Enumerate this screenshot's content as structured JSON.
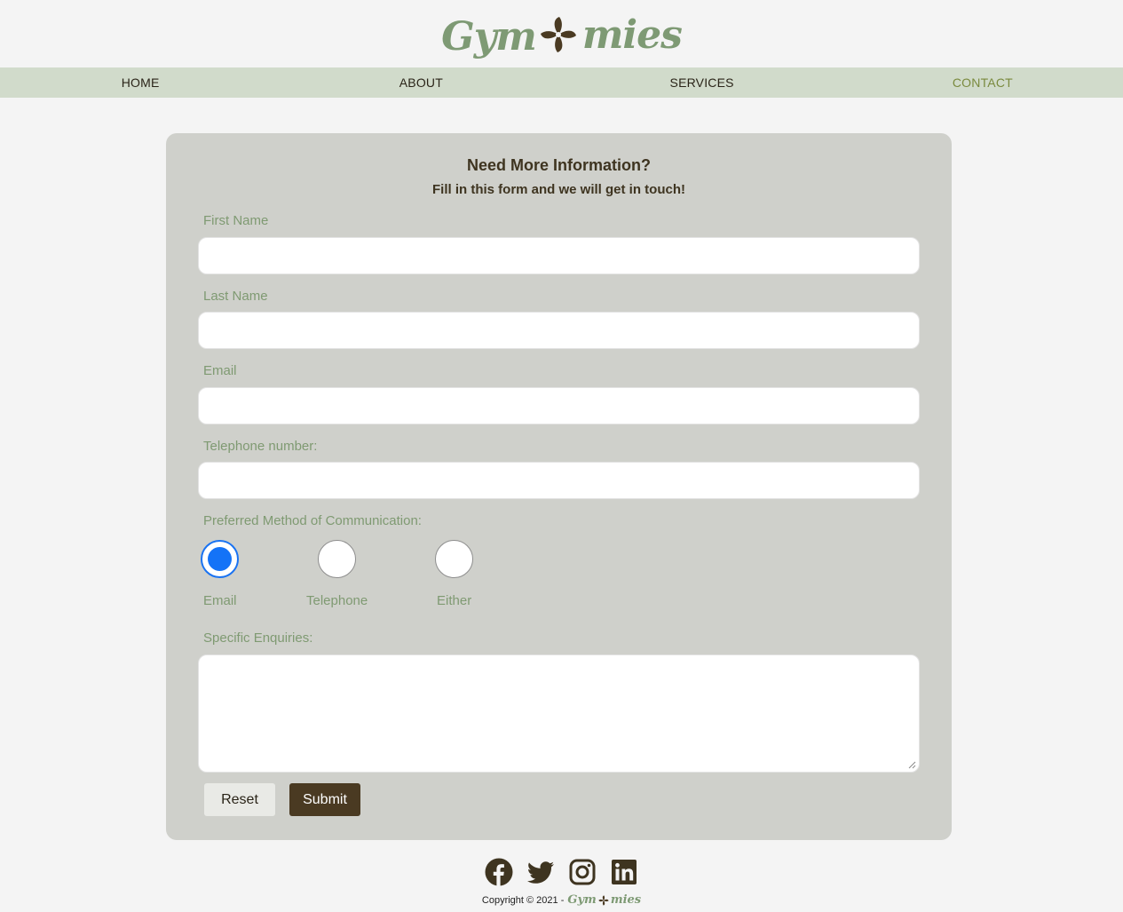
{
  "brand": {
    "logo_left": "Gym",
    "logo_right": "mies",
    "logo_color": "#7e9a74",
    "mark_color": "#4a3a22"
  },
  "nav": {
    "items": [
      {
        "label": "HOME",
        "active": false
      },
      {
        "label": "ABOUT",
        "active": false
      },
      {
        "label": "SERVICES",
        "active": false
      },
      {
        "label": "CONTACT",
        "active": true
      }
    ]
  },
  "form": {
    "title": "Need More Information?",
    "subtitle": "Fill in this form and we will get in touch!",
    "first_name": {
      "label": "First Name",
      "value": ""
    },
    "last_name": {
      "label": "Last Name",
      "value": ""
    },
    "email": {
      "label": "Email",
      "value": ""
    },
    "telephone": {
      "label": "Telephone number:",
      "value": ""
    },
    "preferred_method": {
      "label": "Preferred Method of Communication:",
      "options": [
        "Email",
        "Telephone",
        "Either"
      ],
      "selected": "Email"
    },
    "enquiries": {
      "label": "Specific Enquiries:",
      "value": ""
    },
    "reset_label": "Reset",
    "submit_label": "Submit"
  },
  "footer": {
    "social_icons": [
      "facebook-icon",
      "twitter-icon",
      "instagram-icon",
      "linkedin-icon"
    ],
    "copyright": "Copyright © 2021 - ",
    "icon_color": "#3e3420"
  },
  "colors": {
    "background": "#f4f4f4",
    "nav_bg": "#d1dbcb",
    "card_bg": "#cfd0cb",
    "label_green": "#7f9a72",
    "active_nav": "#7a8a3e",
    "submit_bg": "#4a3a22",
    "radio_blue": "#1473f7"
  }
}
